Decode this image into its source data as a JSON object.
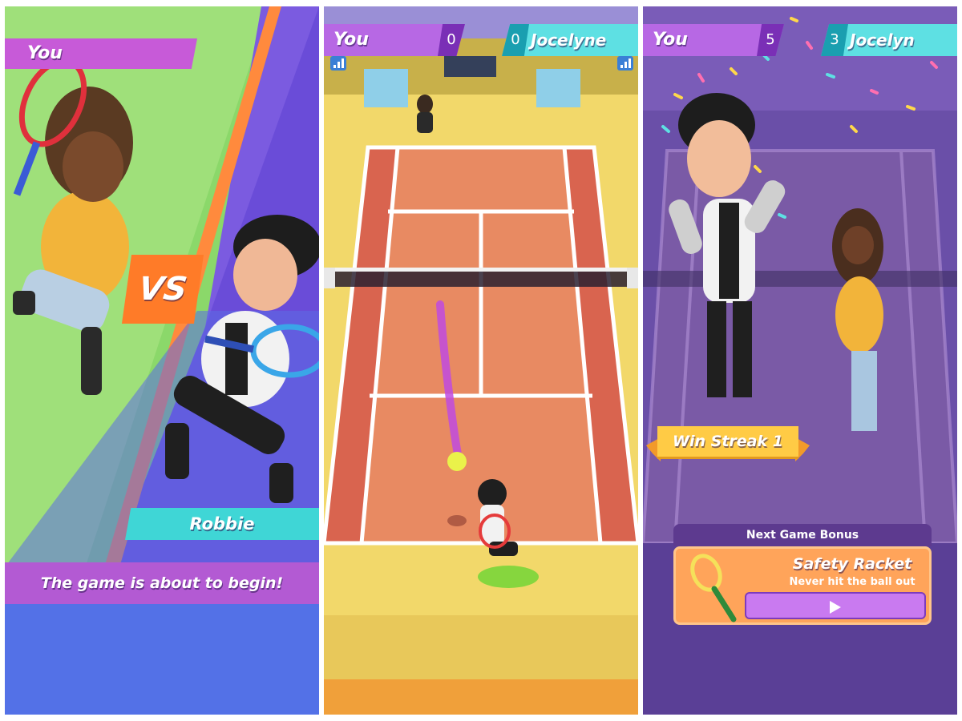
{
  "intro_screen": {
    "player_label": "You",
    "vs_label": "VS",
    "opponent_name": "Robbie",
    "banner_text": "The game is about to begin!"
  },
  "match_screen": {
    "player_label": "You",
    "player_score": "0",
    "opponent_score": "0",
    "opponent_name": "Jocelyne"
  },
  "result_screen": {
    "player_label": "You",
    "player_score": "5",
    "opponent_score": "3",
    "opponent_name": "Jocelyn",
    "win_streak": "Win Streak 1",
    "bonus_header": "Next Game Bonus",
    "bonus_name": "Safety Racket",
    "bonus_description": "Never hit the ball out",
    "play_icon": "play-icon"
  },
  "colors": {
    "purple_accent": "#b768e4",
    "cyan_accent": "#5ee0e3",
    "orange_accent": "#ff7b28",
    "court": "#e8785a"
  }
}
